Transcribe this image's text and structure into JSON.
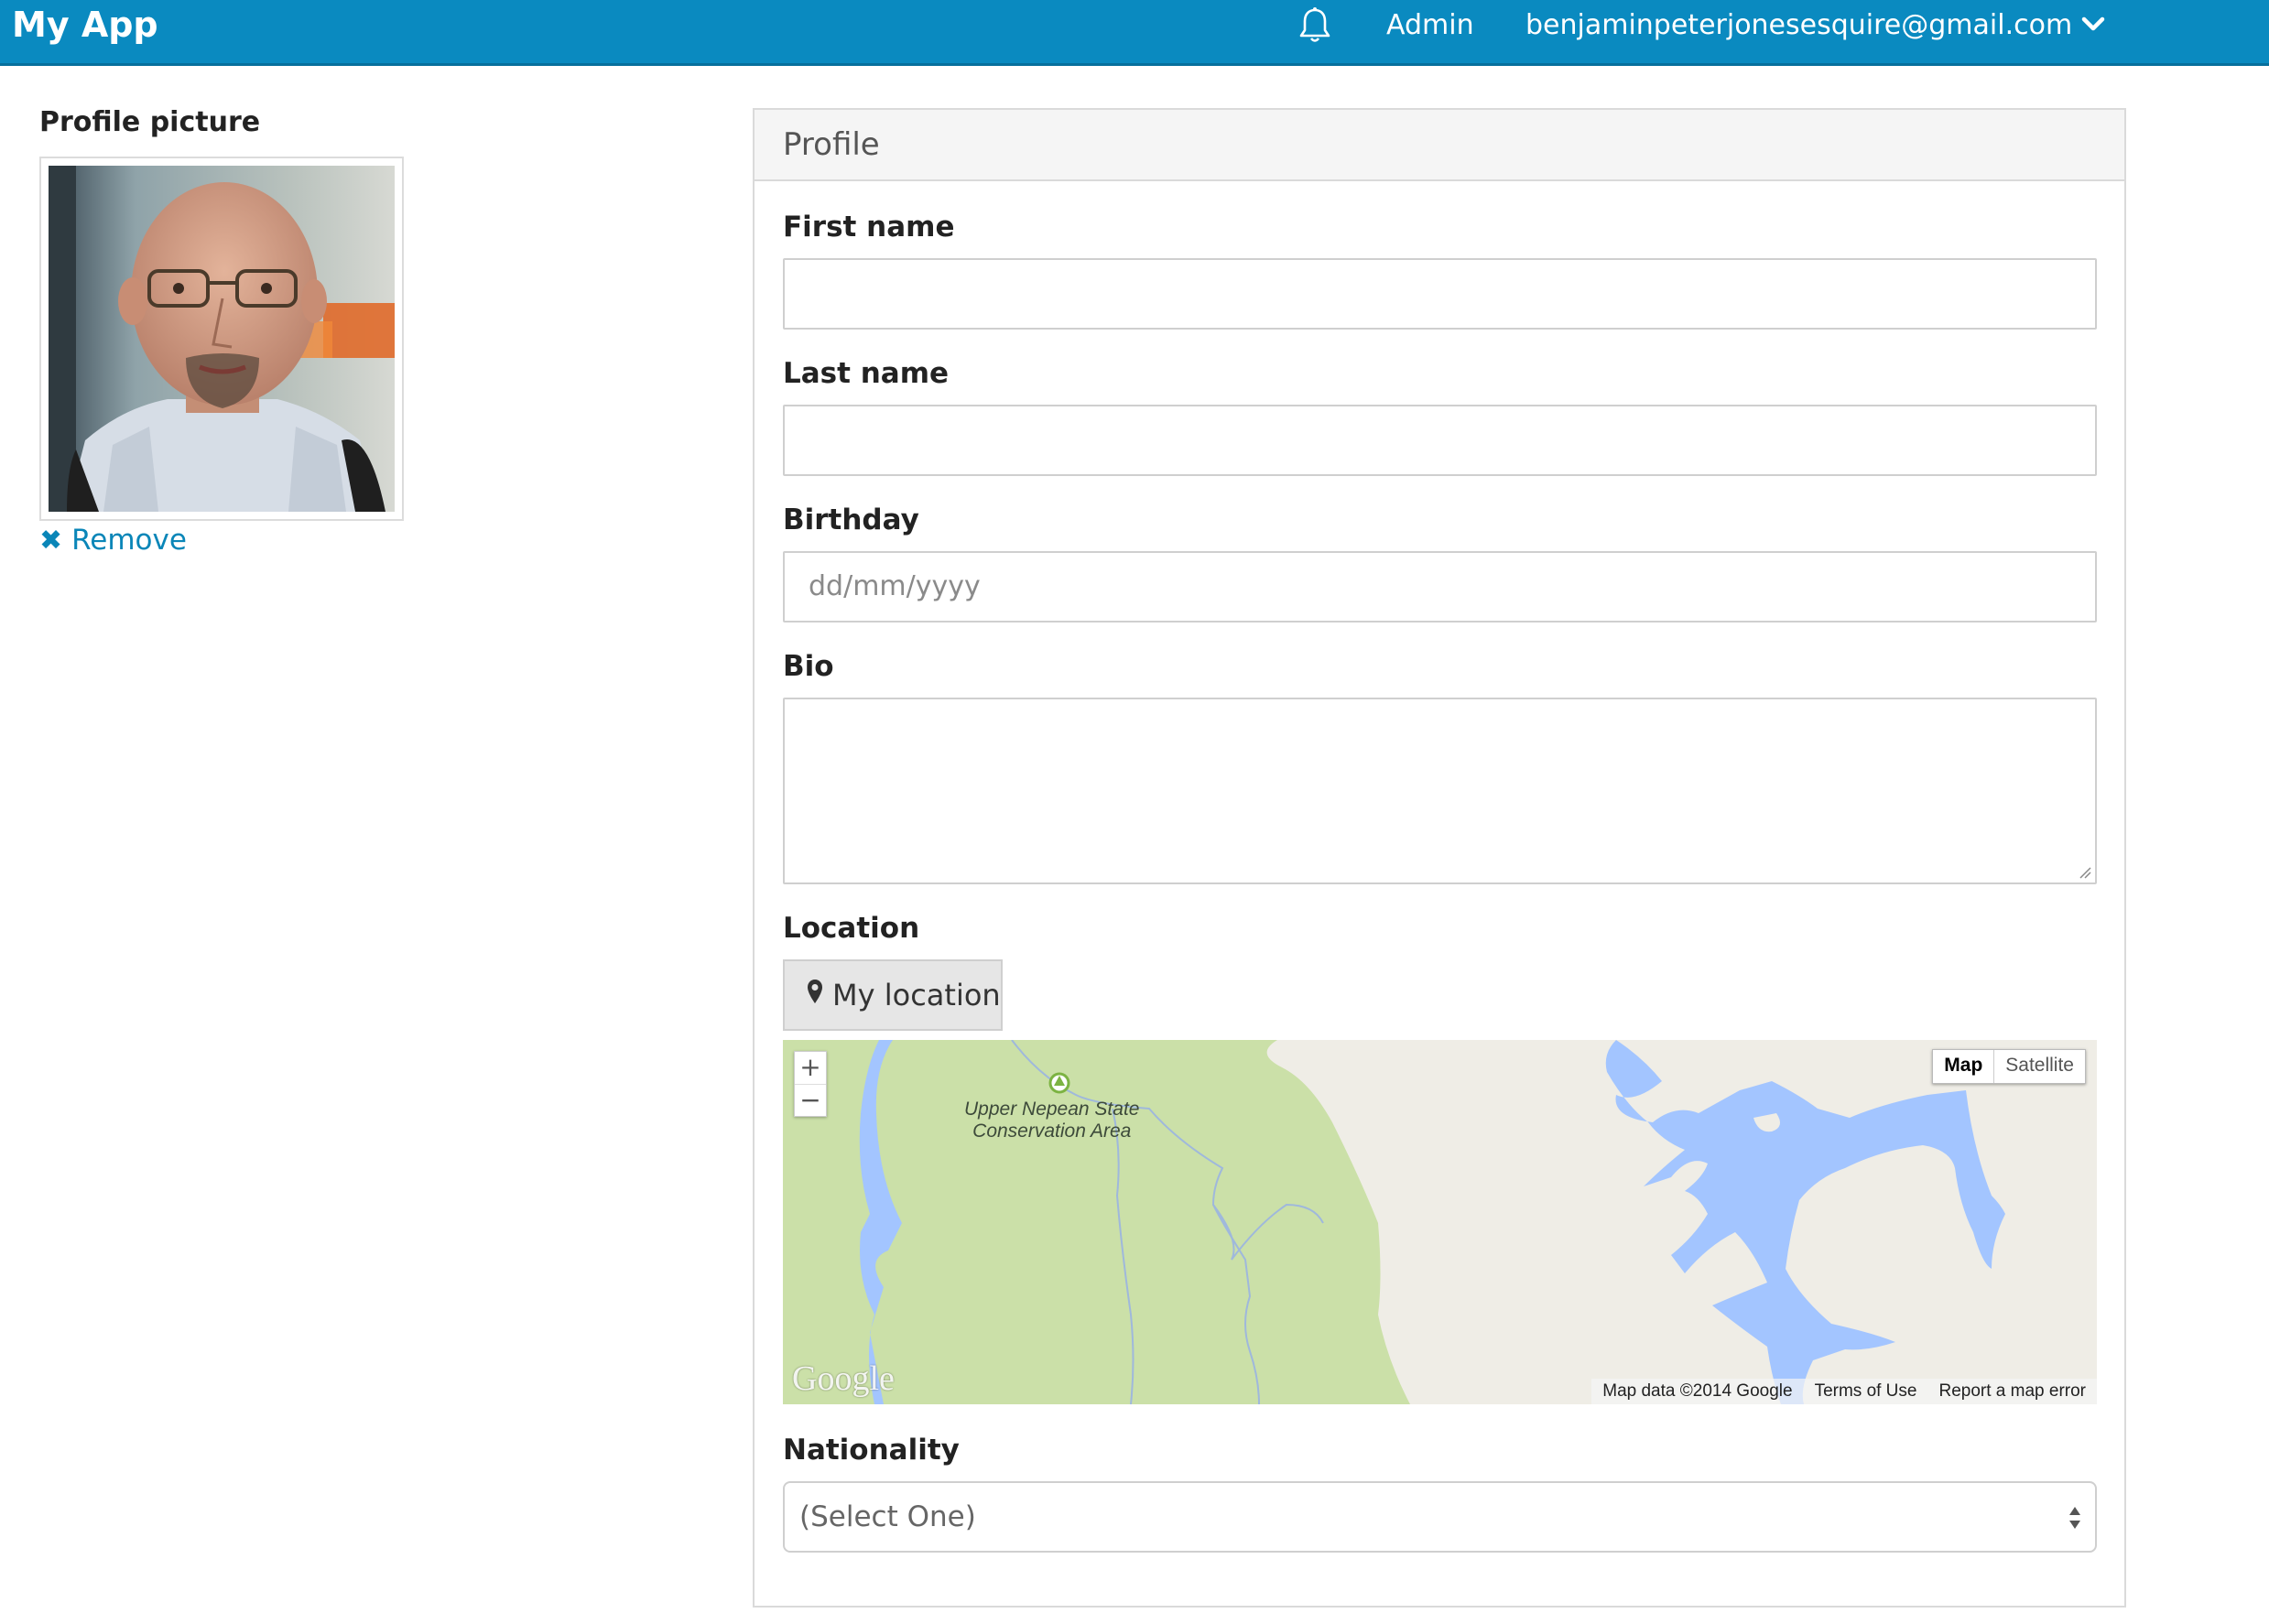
{
  "navbar": {
    "brand": "My App",
    "bell_icon": "bell-icon",
    "admin_label": "Admin",
    "user_email": "benjaminpeterjonesesquire@gmail.com",
    "user_menu_icon": "chevron-down-icon",
    "background_color": "#0a8ac0"
  },
  "profile_picture": {
    "title": "Profile picture",
    "remove_label": "Remove",
    "remove_icon": "close-icon",
    "link_color": "#0a86b8"
  },
  "panel": {
    "title": "Profile",
    "first_name": {
      "label": "First name",
      "value": ""
    },
    "last_name": {
      "label": "Last name",
      "value": ""
    },
    "birthday": {
      "label": "Birthday",
      "placeholder": "dd/mm/yyyy",
      "value": ""
    },
    "bio": {
      "label": "Bio",
      "value": ""
    },
    "location": {
      "label": "Location",
      "button_label": "My location",
      "button_icon": "map-marker-icon"
    },
    "map": {
      "zoom_in": "+",
      "zoom_out": "−",
      "type_map": "Map",
      "type_satellite": "Satellite",
      "poi_name_line1": "Upper Nepean State",
      "poi_name_line2": "Conservation Area",
      "logo_text": "Google",
      "attribution": "Map data ©2014 Google",
      "terms_link": "Terms of Use",
      "report_link": "Report a map error",
      "colors": {
        "land": "#efede6",
        "park": "#cbe0a8",
        "water": "#a3c5ff"
      }
    },
    "nationality": {
      "label": "Nationality",
      "selected": "(Select One)"
    }
  }
}
